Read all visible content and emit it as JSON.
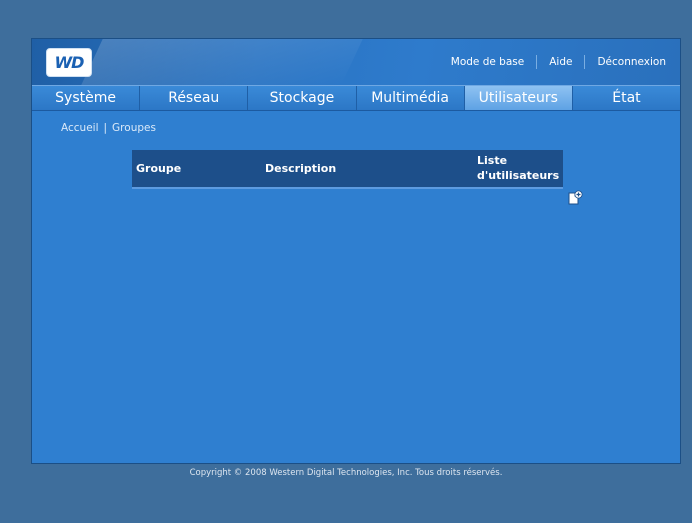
{
  "brand": {
    "logo_text": "WD"
  },
  "top_links": [
    "Mode de base",
    "Aide",
    "Déconnexion"
  ],
  "nav_tabs": [
    "Système",
    "Réseau",
    "Stockage",
    "Multimédia",
    "Utilisateurs",
    "État"
  ],
  "active_tab": "Utilisateurs",
  "breadcrumb": {
    "home": "Accueil",
    "separator": "|",
    "current": "Groupes"
  },
  "table": {
    "columns": {
      "group": "Groupe",
      "description": "Description",
      "users_line1": "Liste",
      "users_line2": "d'utilisateurs"
    },
    "rows": []
  },
  "icons": {
    "add": "add-group-icon"
  },
  "footer": {
    "copyright": "Copyright © 2008 Western Digital Technologies, Inc. Tous droits réservés."
  },
  "colors": {
    "accent": "#2f7fd0",
    "active_tab": "#7cb6ee",
    "table_header": "#1d4f8a"
  }
}
